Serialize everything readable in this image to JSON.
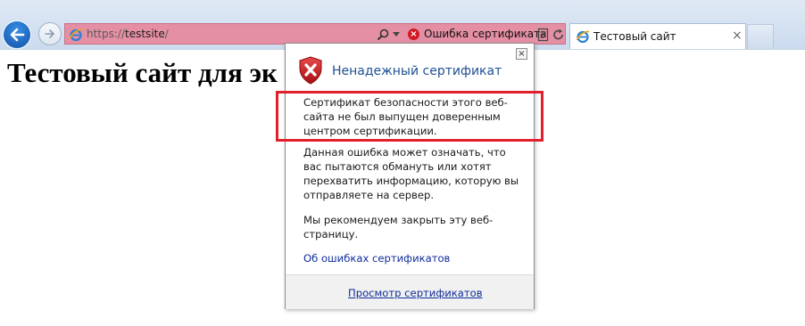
{
  "browser": {
    "address_bar": {
      "url_scheme": "https://",
      "url_host": "testsite",
      "url_path": "/",
      "status_label": "Ошибка сертификата",
      "status_color": "#e48fa4"
    },
    "tab": {
      "title": "Тестовый сайт",
      "close_glyph": "×"
    },
    "icons": [
      "back-arrow-icon",
      "forward-arrow-icon",
      "ie-logo-icon",
      "search-icon",
      "chevron-down-icon",
      "error-icon",
      "compatibility-view-icon",
      "refresh-icon",
      "close-icon",
      "shield-error-icon"
    ]
  },
  "page": {
    "heading": "Тестовый сайт для эк"
  },
  "flyout": {
    "close_glyph": "×",
    "title": "Ненадежный сертификат",
    "paragraph1": "Сертификат безопасности этого веб-сайта не был выпущен доверенным центром сертификации.",
    "paragraph2": "Данная ошибка может означать, что вас пытаются обмануть или хотят перехватить информацию, которую вы отправляете на сервер.",
    "paragraph3": "Мы рекомендуем закрыть эту веб-страницу.",
    "about_link": "Об ошибках сертификатов",
    "view_link": "Просмотр сертификатов",
    "highlight_color": "#e0212b"
  }
}
